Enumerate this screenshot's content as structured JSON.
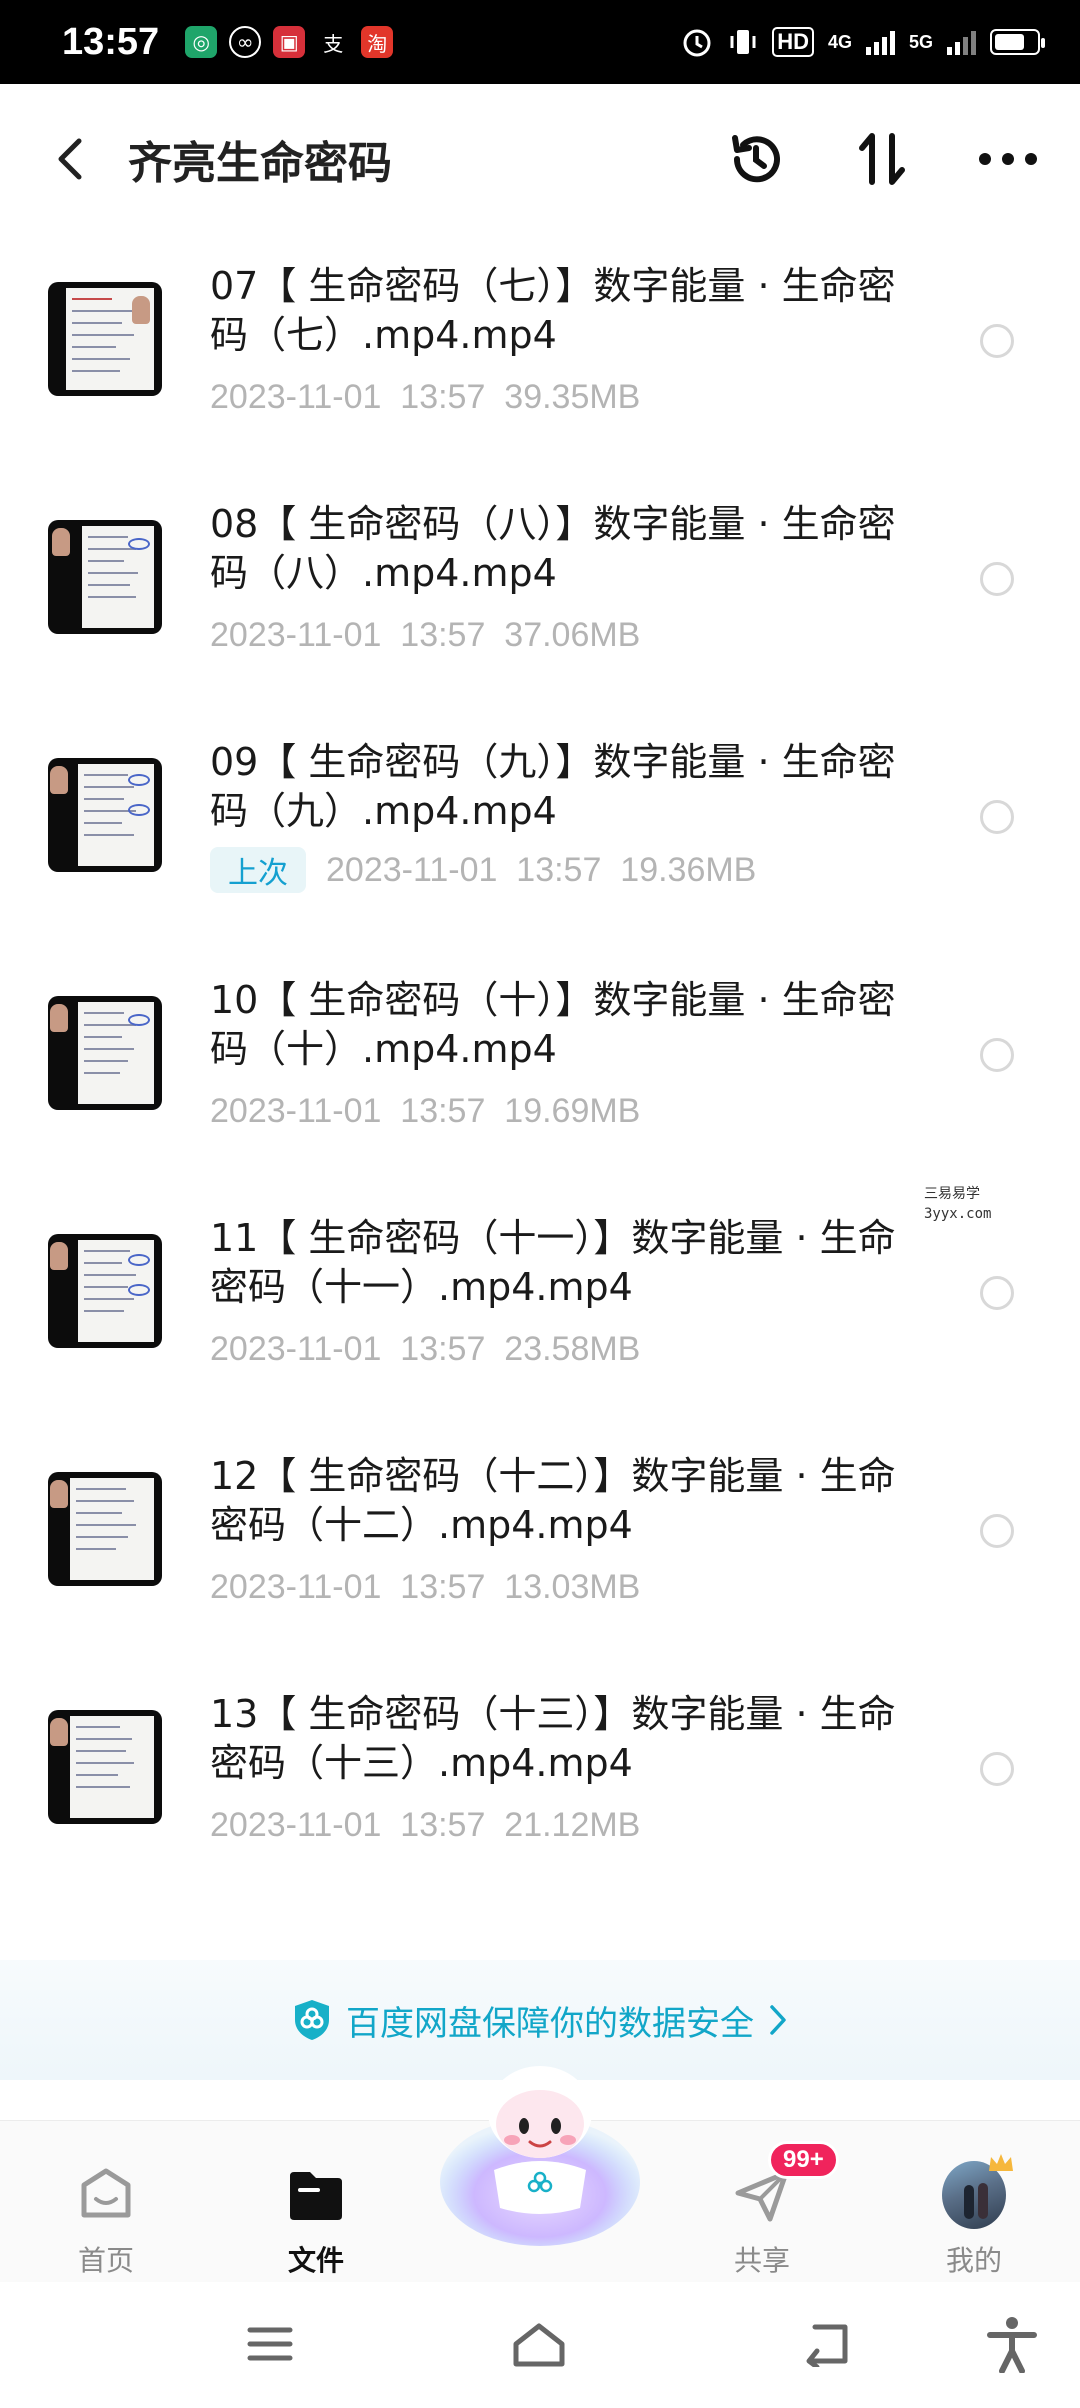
{
  "status_bar": {
    "time": "13:57",
    "signal_labels": [
      "HD",
      "4G",
      "5G"
    ],
    "app_icons": [
      "app-green-icon",
      "app-swirl-icon",
      "app-red-icon",
      "alipay-icon",
      "taobao-icon"
    ]
  },
  "header": {
    "title": "齐亮生命密码"
  },
  "files": [
    {
      "name": "07【 生命密码（七）】数字能量 · 生命密码（七）.mp4.mp4",
      "date": "2023-11-01  13:57",
      "size": "39.35MB",
      "badge": ""
    },
    {
      "name": "08【 生命密码（八）】数字能量 · 生命密码（八）.mp4.mp4",
      "date": "2023-11-01  13:57",
      "size": "37.06MB",
      "badge": ""
    },
    {
      "name": "09【 生命密码（九）】数字能量 · 生命密码（九）.mp4.mp4",
      "date": "2023-11-01  13:57",
      "size": "19.36MB",
      "badge": "上次"
    },
    {
      "name": "10【 生命密码（十）】数字能量 · 生命密码（十）.mp4.mp4",
      "date": "2023-11-01  13:57",
      "size": "19.69MB",
      "badge": ""
    },
    {
      "name": "11【 生命密码（十一）】数字能量 · 生命密码（十一）.mp4.mp4",
      "date": "2023-11-01  13:57",
      "size": "23.58MB",
      "badge": ""
    },
    {
      "name": "12【 生命密码（十二）】数字能量 · 生命密码（十二）.mp4.mp4",
      "date": "2023-11-01  13:57",
      "size": "13.03MB",
      "badge": ""
    },
    {
      "name": "13【 生命密码（十三）】数字能量 · 生命密码（十三）.mp4.mp4",
      "date": "2023-11-01  13:57",
      "size": "21.12MB",
      "badge": ""
    }
  ],
  "watermark": {
    "line1": "三易易学",
    "line2": "3yyx.com"
  },
  "security_banner": {
    "text": "百度网盘保障你的数据安全"
  },
  "tabs": {
    "home": "首页",
    "files": "文件",
    "share": "共享",
    "share_badge": "99+",
    "me": "我的"
  },
  "colors": {
    "accent": "#12a6c8",
    "badge_red": "#f0245c",
    "meta_gray": "#b4b4b4"
  }
}
